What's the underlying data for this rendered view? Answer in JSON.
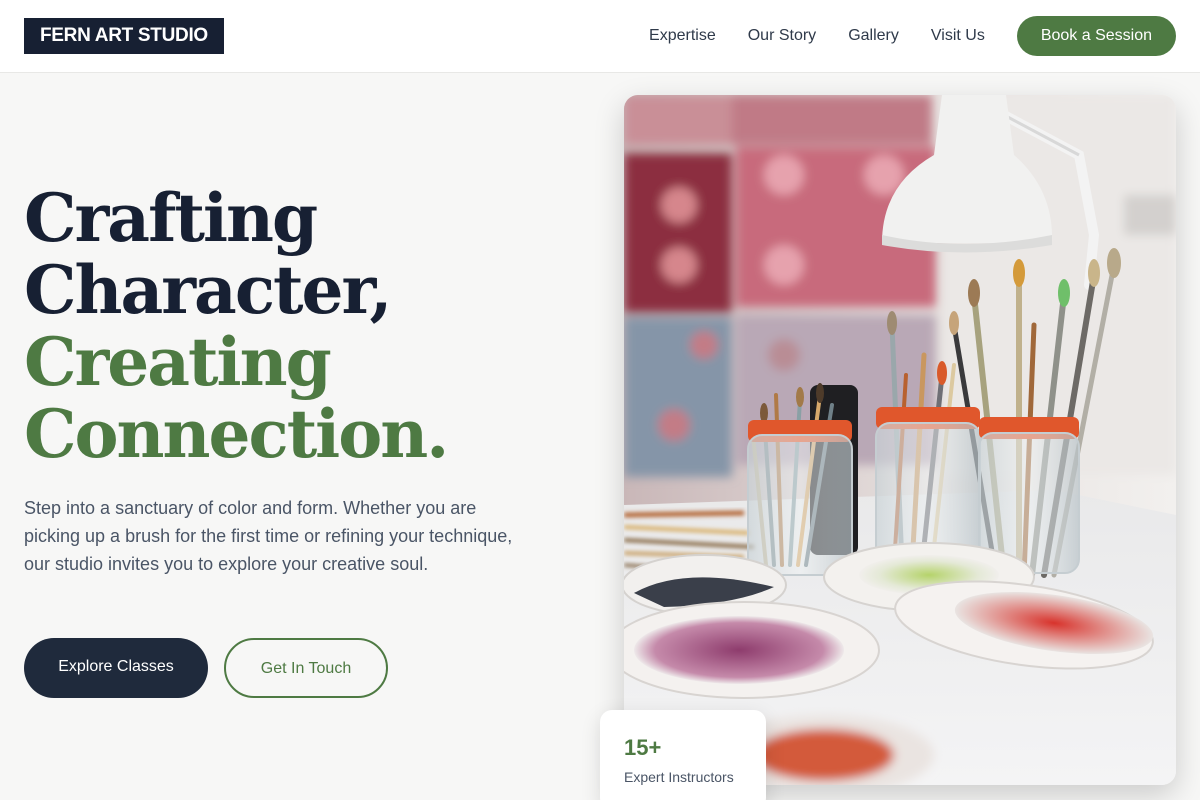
{
  "brand": {
    "name": "FERN ART STUDIO"
  },
  "nav": {
    "items": [
      "Expertise",
      "Our Story",
      "Gallery",
      "Visit Us"
    ],
    "cta": "Book a Session"
  },
  "hero": {
    "headline": {
      "line1": "Crafting",
      "line2": "Character,",
      "line3": "Creating",
      "line4": "Connection."
    },
    "intro": "Step into a sanctuary of color and form. Whether you are picking up a brush for the first time or refining your technique, our studio invites you to explore your creative soul.",
    "primary_button": "Explore Classes",
    "secondary_button": "Get In Touch",
    "image_subject": "art-studio-paint-brushes-photo"
  },
  "stat": {
    "value": "15+",
    "label": "Expert Instructors"
  },
  "colors": {
    "navy": "#172033",
    "green": "#4e7a43",
    "background": "#f7f7f6"
  }
}
